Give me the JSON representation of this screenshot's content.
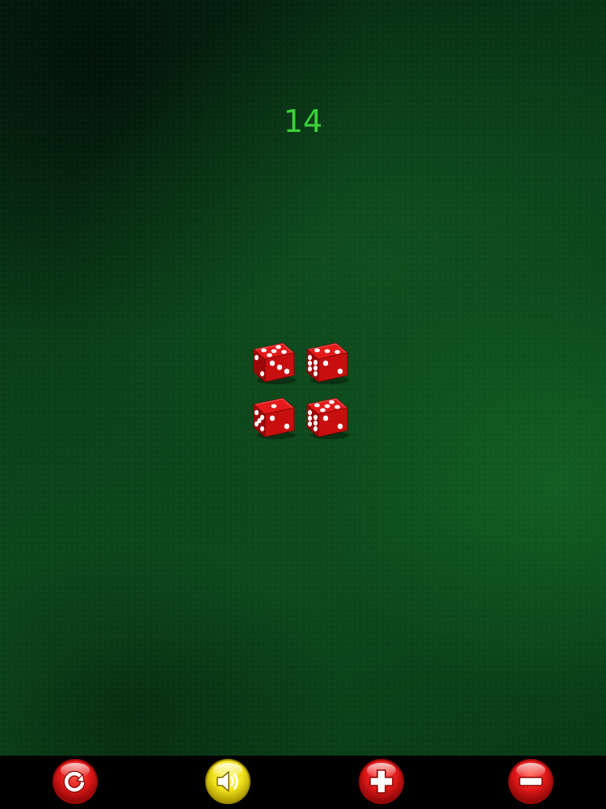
{
  "game": {
    "total": "14"
  },
  "dice": [
    {
      "top_face": 5,
      "side_face": 2,
      "front_face": 3
    },
    {
      "top_face": 3,
      "side_face": 6,
      "front_face": 2
    },
    {
      "top_face": 1,
      "side_face": 5,
      "front_face": 2
    },
    {
      "top_face": 5,
      "side_face": 6,
      "front_face": 2
    }
  ],
  "colors": {
    "felt": "#0b4519",
    "total_text": "#3bd23b",
    "die_red": "#d81414",
    "pip": "#ffffff",
    "button_red": "#e01818",
    "button_yellow": "#f2e21c",
    "toolbar": "#000000"
  },
  "toolbar": {
    "buttons": [
      {
        "name": "reroll",
        "icon": "reroll-icon",
        "color": "red"
      },
      {
        "name": "sound",
        "icon": "speaker-icon",
        "color": "yellow"
      },
      {
        "name": "add-die",
        "icon": "plus-icon",
        "color": "red"
      },
      {
        "name": "remove-die",
        "icon": "minus-icon",
        "color": "red"
      }
    ]
  }
}
